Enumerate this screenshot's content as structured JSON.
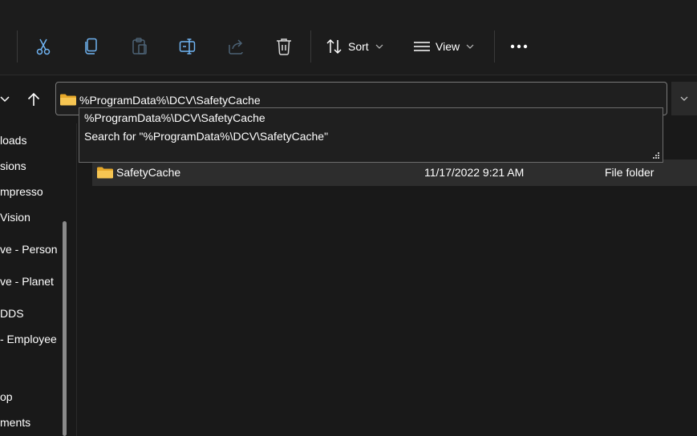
{
  "toolbar": {
    "sort_label": "Sort",
    "view_label": "View",
    "icons": [
      "cut-icon",
      "copy-icon",
      "paste-icon",
      "rename-icon",
      "share-icon",
      "delete-icon",
      "sort-icon",
      "view-icon",
      "more-icon"
    ]
  },
  "address_bar": {
    "value": "%ProgramData%\\DCV\\SafetyCache"
  },
  "suggestions": [
    "%ProgramData%\\DCV\\SafetyCache",
    "Search for \"%ProgramData%\\DCV\\SafetyCache\""
  ],
  "sidebar": {
    "items": [
      "loads",
      "sions",
      "mpresso",
      "Vision",
      "ve - Person",
      "ve - Planet",
      "DDS",
      "- Employee",
      "op",
      "ments"
    ]
  },
  "files": [
    {
      "name": "SafetyCache",
      "date": "11/17/2022 9:21 AM",
      "type": "File folder"
    }
  ],
  "colors": {
    "background": "#191919",
    "toolbar": "#1c1c1c",
    "folder": "#f4c04f",
    "selected_row": "#2d2d2d"
  }
}
